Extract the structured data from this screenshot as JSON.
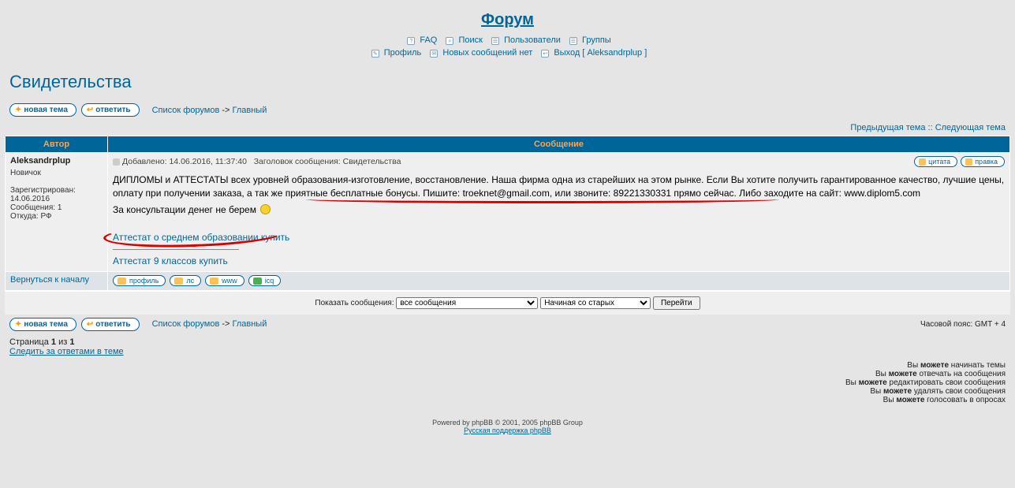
{
  "header": {
    "forum_link": "Форум",
    "nav1": [
      "FAQ",
      "Поиск",
      "Пользователи",
      "Группы"
    ],
    "nav2": [
      "Профиль",
      "Новых сообщений нет",
      "Выход [ Aleksandrplup ]"
    ]
  },
  "topic_title": "Свидетельства",
  "buttons": {
    "new_topic": "новая тема",
    "reply": "ответить"
  },
  "breadcrumbs": {
    "root": "Список форумов",
    "sep": " -> ",
    "forum": "Главный"
  },
  "topic_nav": {
    "prev": "Предыдущая тема",
    "sep": " :: ",
    "next": "Следующая тема"
  },
  "table": {
    "th_author": "Автор",
    "th_message": "Сообщение"
  },
  "post": {
    "author": "Aleksandrplup",
    "rank": "Новичок",
    "reg_label": "Зарегистрирован:",
    "reg_date": "14.06.2016",
    "posts_label": "Сообщения:",
    "posts_count": "1",
    "from_label": "Откуда:",
    "from_val": "РФ",
    "added_label": "Добавлено:",
    "added_val": "14.06.2016, 11:37:40",
    "subject_label": "Заголовок сообщения:",
    "subject_val": "Свидетельства",
    "quote_btn": "цитата",
    "edit_btn": "правка",
    "body_text": "ДИПЛОМЫ и АТТЕСТАТЫ всех уровней образования-изготовление, восстановление. Наша фирма одна из старейших на этом рынке. Если Вы хотите получить гарантированное качество, лучшие цены, оплату при получении заказа, а так же приятные бесплатные бонусы. Пишите: troeknet@gmail.com, или звоните: 89221330331 прямо сейчас. Либо заходите на сайт: www.diplom5.com",
    "body_text2": "За консультации денег не берем",
    "link1": "Аттестат о среднем образовании купить",
    "link2": "Аттестат 9 классов купить",
    "back_to_top": "Вернуться к началу",
    "profile_btns": [
      "профиль",
      "лс",
      "www",
      "icq"
    ]
  },
  "options": {
    "label": "Показать сообщения:",
    "range_selected": "все сообщения",
    "order_selected": "Начиная со старых",
    "go": "Перейти"
  },
  "footer_row": {
    "tz": "Часовой пояс: GMT + 4"
  },
  "page": {
    "info_prefix": "Страница ",
    "page_cur": "1",
    "page_of": " из ",
    "page_total": "1",
    "watch": "Следить за ответами в теме"
  },
  "permissions": [
    {
      "pre": "Вы ",
      "b": "можете",
      "post": " начинать темы"
    },
    {
      "pre": "Вы ",
      "b": "можете",
      "post": " отвечать на сообщения"
    },
    {
      "pre": "Вы ",
      "b": "можете",
      "post": " редактировать свои сообщения"
    },
    {
      "pre": "Вы ",
      "b": "можете",
      "post": " удалять свои сообщения"
    },
    {
      "pre": "Вы ",
      "b": "можете",
      "post": " голосовать в опросах"
    }
  ],
  "copyright": {
    "line1": "Powered by phpBB © 2001, 2005 phpBB Group",
    "line2": "Русская поддержка phpBB"
  }
}
